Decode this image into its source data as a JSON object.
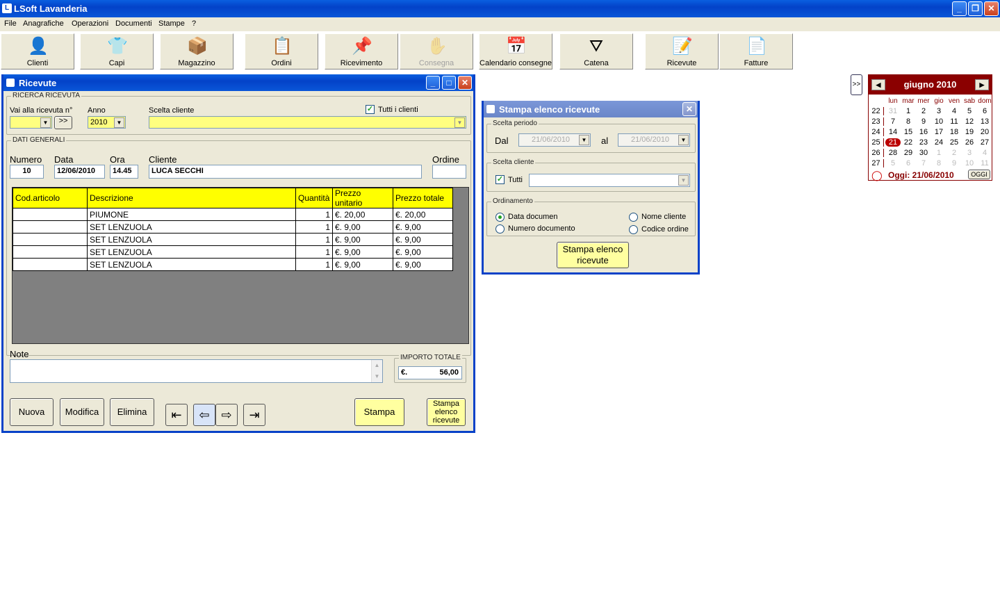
{
  "app": {
    "title": "LSoft Lavanderia"
  },
  "menu": [
    "File",
    "Anagrafiche",
    "Operazioni",
    "Documenti",
    "Stampe",
    "?"
  ],
  "toolbar": [
    {
      "label": "Clienti",
      "icon": "person-icon",
      "glyph": "👤"
    },
    {
      "label": "Capi",
      "icon": "clothes-icon",
      "glyph": "👕"
    },
    {
      "label": "Magazzino",
      "icon": "box-icon",
      "glyph": "📦"
    },
    {
      "label": "Ordini",
      "icon": "notepad-icon",
      "glyph": "📋"
    },
    {
      "label": "Ricevimento",
      "icon": "clipboard-icon",
      "glyph": "📌"
    },
    {
      "label": "Consegna",
      "icon": "delivery-icon",
      "glyph": "✋"
    },
    {
      "label": "Calendario consegne",
      "icon": "calendar-icon",
      "glyph": "📅"
    },
    {
      "label": "Catena",
      "icon": "hanger-icon",
      "glyph": "⛛"
    },
    {
      "label": "Ricevute",
      "icon": "receipt-icon",
      "glyph": "📝"
    },
    {
      "label": "Fatture",
      "icon": "invoice-icon",
      "glyph": "📄"
    }
  ],
  "ricevute": {
    "title": "Ricevute",
    "search_group": "RICERCA RICEVUTA",
    "goto_label": "Vai alla ricevuta n°",
    "goto_btn": ">>",
    "anno_label": "Anno",
    "anno_value": "2010",
    "cliente_label": "Scelta cliente",
    "tutti_clienti": "Tutti i clienti",
    "general_group": "DATI GENERALI",
    "numero_label": "Numero",
    "numero": "10",
    "data_label": "Data",
    "data": "12/06/2010",
    "ora_label": "Ora",
    "ora": "14.45",
    "cliente_field_label": "Cliente",
    "cliente": "LUCA SECCHI",
    "ordine_label": "Ordine",
    "columns": [
      "Cod.articolo",
      "Descrizione",
      "Quantità",
      "Prezzo unitario",
      "Prezzo totale"
    ],
    "rows": [
      [
        "",
        "PIUMONE",
        "1",
        "€. 20,00",
        "€. 20,00"
      ],
      [
        "",
        "SET LENZUOLA",
        "1",
        "€. 9,00",
        "€. 9,00"
      ],
      [
        "",
        "SET LENZUOLA",
        "1",
        "€. 9,00",
        "€. 9,00"
      ],
      [
        "",
        "SET LENZUOLA",
        "1",
        "€. 9,00",
        "€. 9,00"
      ],
      [
        "",
        "SET LENZUOLA",
        "1",
        "€. 9,00",
        "€. 9,00"
      ]
    ],
    "note_label": "Note",
    "importo_label": "IMPORTO TOTALE",
    "importo_currency": "€.",
    "importo_value": "56,00",
    "btn_nuova": "Nuova",
    "btn_modifica": "Modifica",
    "btn_elimina": "Elimina",
    "btn_stampa": "Stampa",
    "btn_stampa_elenco": "Stampa elenco ricevute"
  },
  "stampa": {
    "title": "Stampa elenco ricevute",
    "periodo_group": "Scelta periodo",
    "dal_label": "Dal",
    "dal_value": "21/06/2010",
    "al_label": "al",
    "al_value": "21/06/2010",
    "cliente_group": "Scelta cliente",
    "tutti_label": "Tutti",
    "ordinamento_group": "Ordinamento",
    "opt_data": "Data documen",
    "opt_numero": "Numero documento",
    "opt_nome": "Nome cliente",
    "opt_codice": "Codice ordine",
    "btn_stampa": "Stampa elenco ricevute"
  },
  "calendar": {
    "toggle": ">>",
    "month": "giugno 2010",
    "days": [
      "lun",
      "mar",
      "mer",
      "gio",
      "ven",
      "sab",
      "dom"
    ],
    "weeks": [
      "22",
      "23",
      "24",
      "25",
      "26",
      "27"
    ],
    "grid": [
      [
        "31",
        "1",
        "2",
        "3",
        "4",
        "5",
        "6"
      ],
      [
        "7",
        "8",
        "9",
        "10",
        "11",
        "12",
        "13"
      ],
      [
        "14",
        "15",
        "16",
        "17",
        "18",
        "19",
        "20"
      ],
      [
        "21",
        "22",
        "23",
        "24",
        "25",
        "26",
        "27"
      ],
      [
        "28",
        "29",
        "30",
        "1",
        "2",
        "3",
        "4"
      ],
      [
        "5",
        "6",
        "7",
        "8",
        "9",
        "10",
        "11"
      ]
    ],
    "today_label": "Oggi: 21/06/2010",
    "today_btn": "OGGI"
  }
}
